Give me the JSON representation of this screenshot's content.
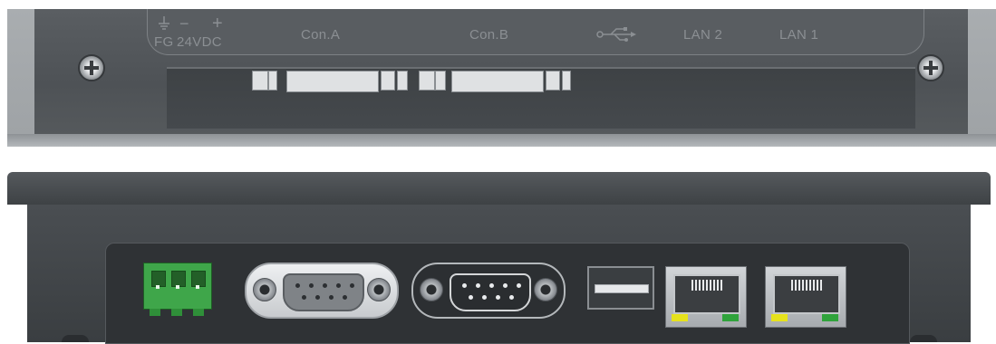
{
  "top_view": {
    "labels": {
      "fg": "FG",
      "voltage": "24VDC",
      "minus": "−",
      "plus": "+",
      "con_a": "Con.A",
      "con_b": "Con.B",
      "lan2": "LAN 2",
      "lan1": "LAN 1"
    },
    "icons": [
      "ground-icon",
      "usb-icon",
      "screw-icon"
    ]
  },
  "bottom_view": {
    "ports": [
      "power-terminal",
      "con-a-dsub9",
      "con-b-dsub9",
      "usb-port",
      "lan2-rj45",
      "lan1-rj45"
    ],
    "colors": {
      "terminal": "#3fa64a",
      "led_yellow": "#e6e21c",
      "led_green": "#2fa33b",
      "housing": "#3a3e41"
    }
  }
}
